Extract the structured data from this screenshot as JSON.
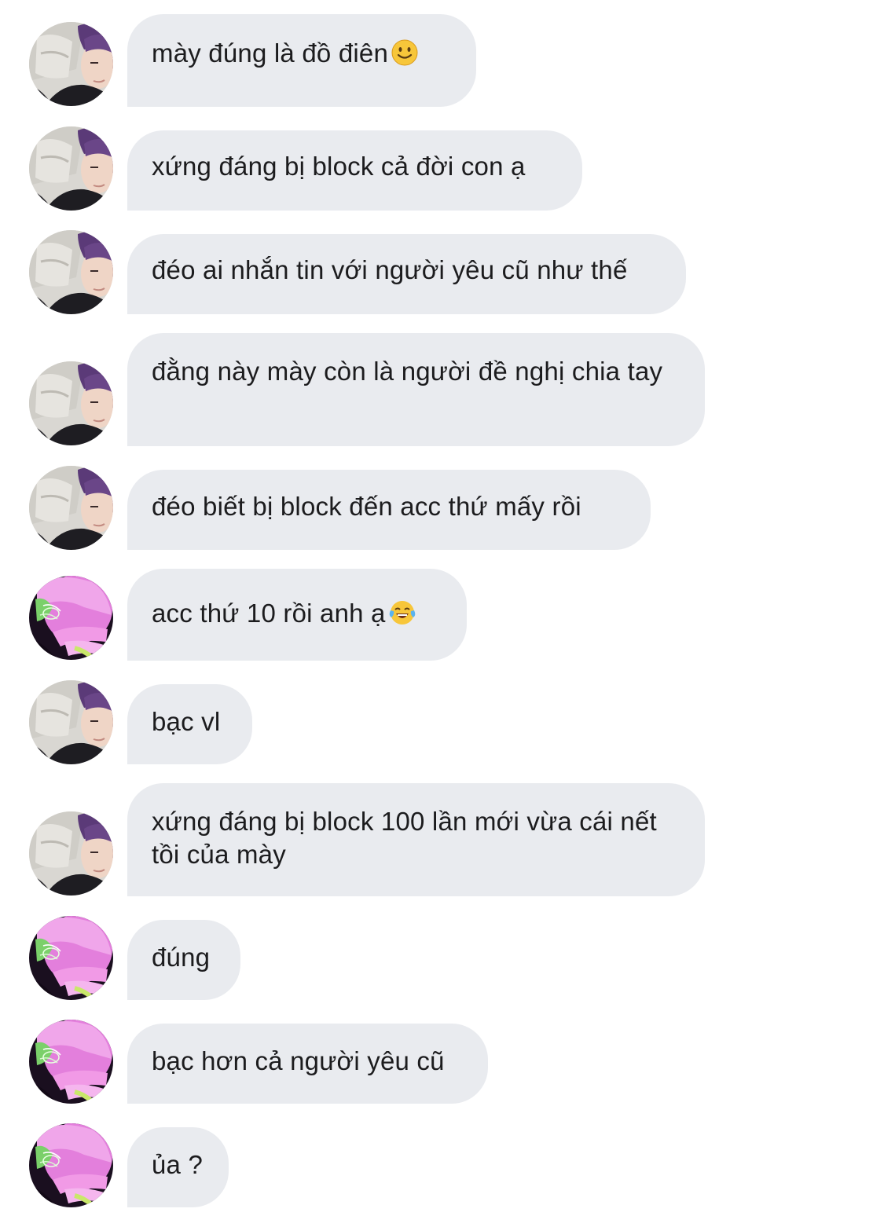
{
  "conversation": {
    "messages": [
      {
        "sender": "friend",
        "avatar": "friend-avatar",
        "text": "mày đúng là đồ điên",
        "emoji": "slightly-smiling-face-icon"
      },
      {
        "sender": "friend",
        "avatar": "friend-avatar",
        "text": "xứng đáng bị block cả đời con ạ",
        "emoji": ""
      },
      {
        "sender": "friend",
        "avatar": "friend-avatar",
        "text": "đéo ai nhắn tin với người yêu cũ như thế",
        "emoji": ""
      },
      {
        "sender": "friend",
        "avatar": "friend-avatar",
        "text": "đằng này mày còn là người đề nghị chia tay",
        "emoji": ""
      },
      {
        "sender": "friend",
        "avatar": "friend-avatar",
        "text": "đéo biết bị block đến acc thứ mấy rồi",
        "emoji": ""
      },
      {
        "sender": "user",
        "avatar": "user-avatar",
        "text": "acc thứ 10 rồi anh ạ",
        "emoji": "tears-of-joy-icon"
      },
      {
        "sender": "friend",
        "avatar": "friend-avatar",
        "text": "bạc vl",
        "emoji": ""
      },
      {
        "sender": "friend",
        "avatar": "friend-avatar",
        "text": "xứng đáng bị block 100 lần mới vừa cái nết tồi của mày",
        "emoji": ""
      },
      {
        "sender": "user",
        "avatar": "user-avatar",
        "text": "đúng",
        "emoji": ""
      },
      {
        "sender": "user",
        "avatar": "user-avatar",
        "text": "bạc hơn cả người yêu cũ",
        "emoji": ""
      },
      {
        "sender": "user",
        "avatar": "user-avatar",
        "text": "ủa ?",
        "emoji": ""
      }
    ]
  },
  "colors": {
    "bubble_bg": "#e9ebef",
    "text": "#1c1c1e",
    "friend_avatar_hair": "#5b3a78",
    "user_avatar_tint": "#e07ad8"
  }
}
